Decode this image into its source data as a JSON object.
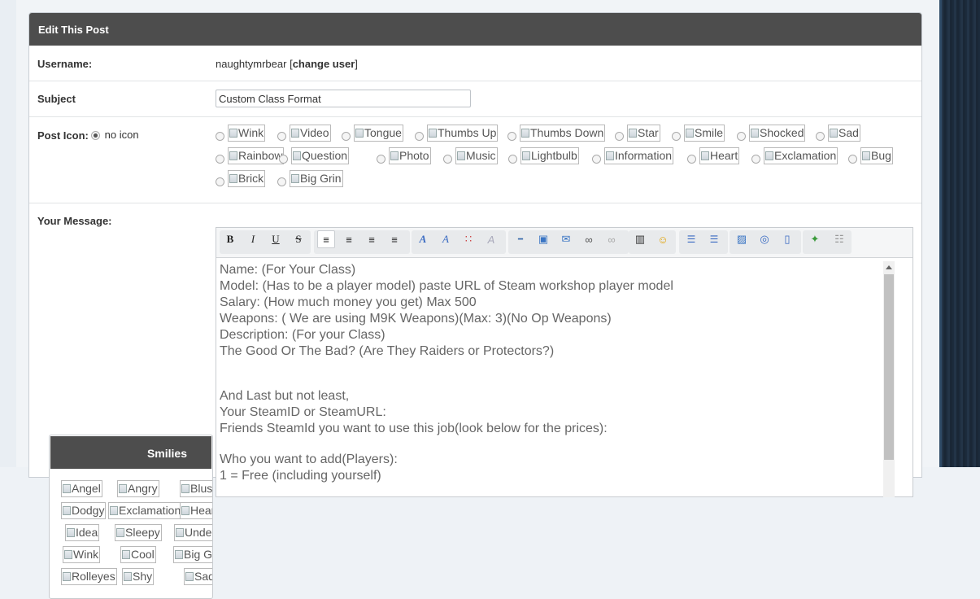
{
  "panel": {
    "title": "Edit This Post"
  },
  "username": {
    "label": "Username:",
    "value": "naughtymrbear",
    "bracket_open": " [",
    "change": "change user",
    "bracket_close": "]"
  },
  "subject": {
    "label": "Subject",
    "value": "Custom Class Format"
  },
  "post_icon": {
    "label": "Post Icon:",
    "no_icon_label": "no icon",
    "selected": "no icon",
    "icons": [
      "Wink",
      "Video",
      "Tongue",
      "Thumbs Up",
      "Thumbs Down",
      "Star",
      "Smile",
      "Shocked",
      "Sad",
      "Rainbow",
      "Question",
      "Photo",
      "Music",
      "Lightbulb",
      "Information",
      "Heart",
      "Exclamation",
      "Bug",
      "Brick",
      "Big Grin"
    ]
  },
  "message": {
    "label": "Your Message:"
  },
  "smilies": {
    "title": "Smilies",
    "items": [
      "Angel",
      "Angry",
      "Blush",
      "Dodgy",
      "Exclamation",
      "Heart",
      "Idea",
      "Sleepy",
      "Undecided",
      "Wink",
      "Cool",
      "Big Grin",
      "Rolleyes",
      "Shy",
      "Sad"
    ]
  },
  "toolbar": {
    "buttons": [
      "bold",
      "italic",
      "underline",
      "strikethrough",
      "align-left",
      "align-center",
      "align-right",
      "justify",
      "font",
      "font-size",
      "color",
      "remove-format",
      "horizontal-rule",
      "image",
      "email",
      "link",
      "unlink",
      "video",
      "emoticon",
      "bullet-list",
      "ordered-list",
      "code",
      "php",
      "quote",
      "maximize",
      "source"
    ]
  },
  "editor_text": {
    "lines": [
      "Name: (For Your Class)",
      "Model: (Has to be a player model) paste URL of Steam workshop player model",
      "Salary: (How much money you get) Max 500",
      "Weapons: ( We are using M9K Weapons)(Max: 3)(No Op Weapons)",
      "Description: (For your Class)",
      "The Good Or The Bad? (Are They Raiders or Protectors?)",
      "",
      "",
      "And Last but not least,",
      "Your SteamID or SteamURL:",
      "Friends SteamId you want to use this job(look below for the prices):",
      "",
      "Who you want to add(Players):",
      "1 = Free (including yourself)"
    ]
  },
  "colors": {
    "header_bg": "#4d4d4d",
    "sidebar_dark": "#1c2b3c"
  }
}
